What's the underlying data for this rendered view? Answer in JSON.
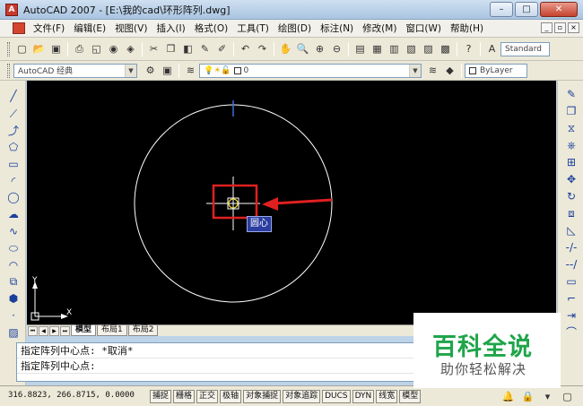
{
  "window": {
    "title": "AutoCAD 2007 - [E:\\我的cad\\环形阵列.dwg]",
    "app_icon_label": "A"
  },
  "menu": {
    "items": [
      "文件(F)",
      "编辑(E)",
      "视图(V)",
      "插入(I)",
      "格式(O)",
      "工具(T)",
      "绘图(D)",
      "标注(N)",
      "修改(M)",
      "窗口(W)",
      "帮助(H)"
    ]
  },
  "toolbar": {
    "text_style": "Standard",
    "workspace": "AutoCAD 经典",
    "layer_value": "0",
    "linetype": "ByLayer"
  },
  "canvas": {
    "tooltip": "圆心",
    "ucs_x_label": "X",
    "ucs_y_label": "Y",
    "colors": {
      "background": "#000000",
      "circle": "#ffffff",
      "highlight": "#e02020",
      "tooltip_bg": "#2a3da0"
    }
  },
  "layout_tabs": [
    "模型",
    "布局1",
    "布局2"
  ],
  "command": {
    "line1": "指定阵列中心点: *取消*",
    "line2": "指定阵列中心点:"
  },
  "status": {
    "coordinates": "316.8823,  266.8715, 0.0000",
    "buttons": [
      "捕捉",
      "栅格",
      "正交",
      "极轴",
      "对象捕捉",
      "对象追踪",
      "DUCS",
      "DYN",
      "线宽",
      "模型"
    ]
  },
  "watermark": {
    "title": "百科全说",
    "subtitle": "助你轻松解决"
  }
}
